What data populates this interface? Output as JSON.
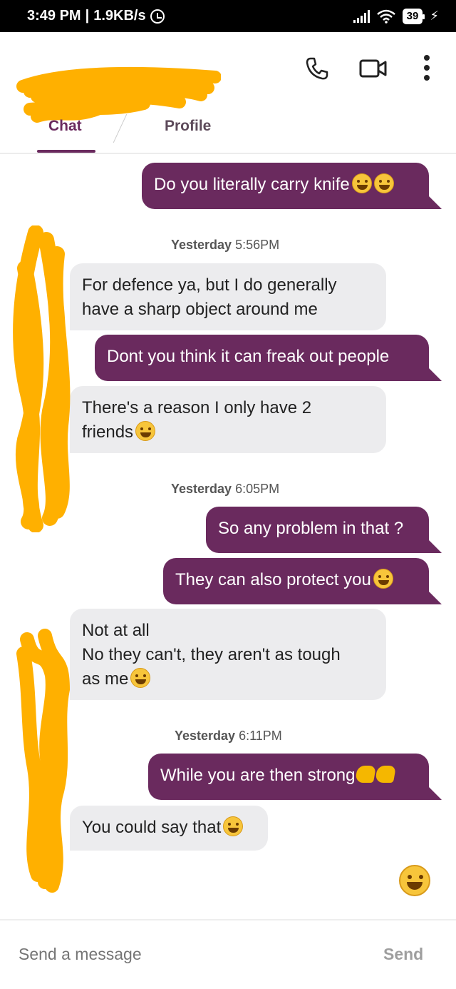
{
  "status_bar": {
    "time": "3:49 PM",
    "separator": "|",
    "speed": "1.9KB/s",
    "battery": "39"
  },
  "header": {
    "icons": [
      "phone-icon",
      "video-icon",
      "more-vert-icon"
    ]
  },
  "tabs": {
    "chat": "Chat",
    "profile": "Profile",
    "active": "Chat"
  },
  "messages": {
    "m1": "Do you literally carry knife",
    "ts1_day": "Yesterday",
    "ts1_time": "5:56PM",
    "m2_line1": "For defence ya, but I do generally",
    "m2_line2": "have a sharp object around me",
    "m3": "Dont you think it can freak out people",
    "m4_line1": "There's a reason I only have 2",
    "m4_line2": "friends",
    "ts2_day": "Yesterday",
    "ts2_time": "6:05PM",
    "m5": "So any problem in that ?",
    "m6": "They can also protect you",
    "m7_line1": "Not at all",
    "m7_line2": "No they can't, they aren't as tough",
    "m7_line3": "as me",
    "ts3_day": "Yesterday",
    "ts3_time": "6:11PM",
    "m8": "While you are then strong",
    "m9": "You could say that"
  },
  "composer": {
    "placeholder": "Send a message",
    "send_label": "Send"
  },
  "colors": {
    "accent": "#6a2a5e",
    "incoming_bubble": "#ececee",
    "redaction": "#ffb000"
  }
}
